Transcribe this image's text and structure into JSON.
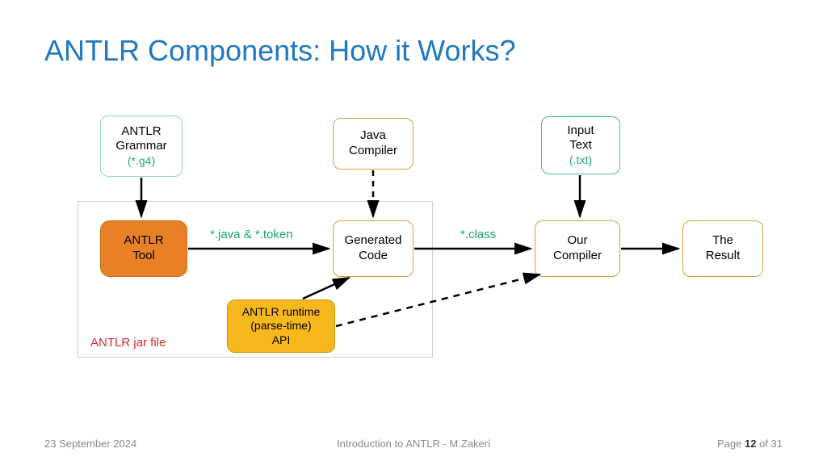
{
  "title": "ANTLR Components: How it Works?",
  "nodes": {
    "grammar": {
      "line1": "ANTLR",
      "line2": "Grammar",
      "sub": "(*.g4)"
    },
    "javac": {
      "line1": "Java",
      "line2": "Compiler"
    },
    "input": {
      "line1": "Input",
      "line2": "Text",
      "sub": "(.txt)"
    },
    "tool": {
      "line1": "ANTLR",
      "line2": "Tool"
    },
    "gen": {
      "line1": "Generated",
      "line2": "Code"
    },
    "runtime": {
      "line1": "ANTLR runtime",
      "line2": "(parse-time)",
      "line3": "API"
    },
    "our": {
      "line1": "Our",
      "line2": "Compiler"
    },
    "result": {
      "line1": "The",
      "line2": "Result"
    }
  },
  "edge_labels": {
    "tool_to_gen": "*.java & *.token",
    "gen_to_our": "*.class"
  },
  "jar_label": "ANTLR jar file",
  "footer": {
    "date": "23 September 2024",
    "title": "Introduction to ANTLR - M.Zakeri",
    "page_prefix": "Page ",
    "page_current": "12",
    "page_of": " of ",
    "page_total": "31"
  }
}
